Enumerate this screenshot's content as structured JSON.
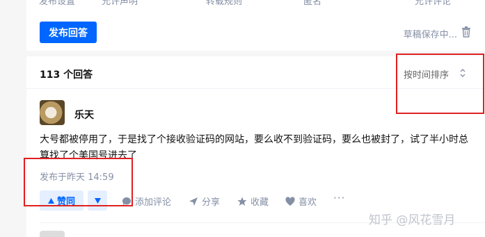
{
  "top_card": {
    "cut_off_texts": [
      "发布设置",
      "允许声明",
      "转载规则",
      "匿名",
      "允许评论"
    ],
    "publish_label": "发布回答",
    "draft_status": "草稿保存中..."
  },
  "answers": {
    "count_label": "113 个回答",
    "sort_label": "按时间排序",
    "author": "乐天",
    "content": "大号都被停用了，于是找了个接收验证码的网站，要么收不到验证码，要么也被封了，试了半小时总算找了个美国号进去了",
    "time": "发布于昨天 14:59",
    "vote_up_label": "赞同",
    "actions": {
      "comment": "添加评论",
      "share": "分享",
      "favorite": "收藏",
      "like": "喜欢",
      "more": "···"
    }
  },
  "watermark": "知乎 @风花雪月",
  "colors": {
    "accent": "#0066ff",
    "annotation_red": "#e02020",
    "muted_text": "#8590a6"
  },
  "icons": [
    "trash-icon",
    "sort-chevron-icon",
    "triangle-up-icon",
    "triangle-down-icon",
    "comment-icon",
    "share-icon",
    "star-icon",
    "heart-icon",
    "more-icon"
  ]
}
